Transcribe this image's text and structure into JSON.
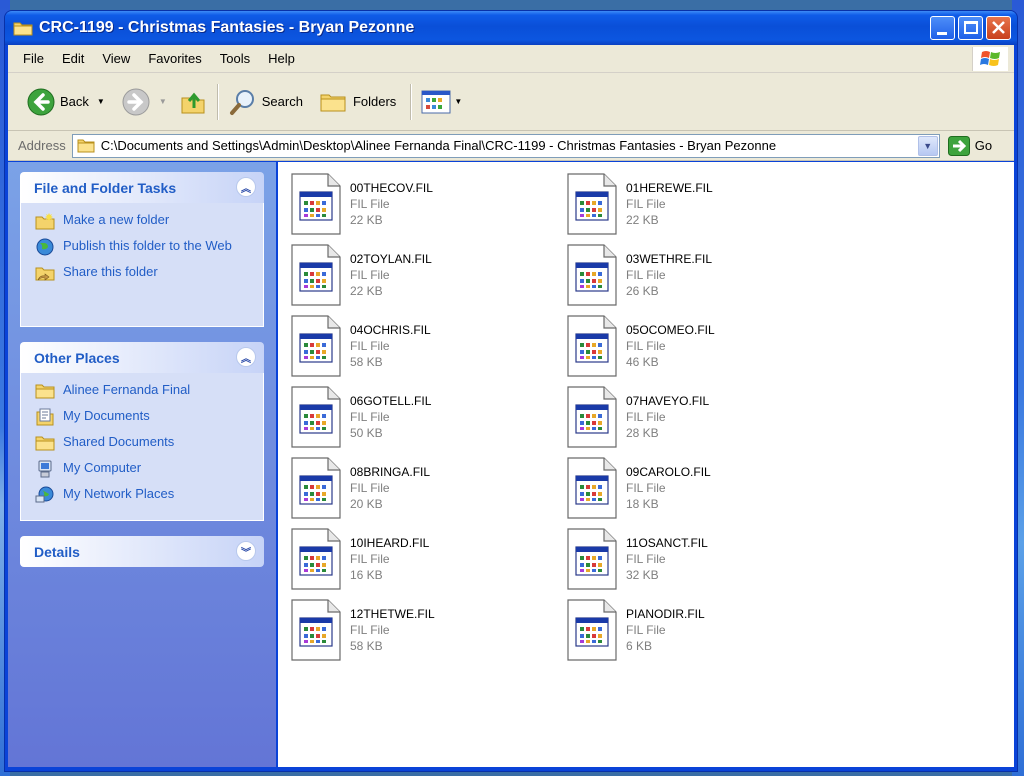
{
  "window": {
    "title": "CRC-1199 - Christmas Fantasies - Bryan Pezonne"
  },
  "menu": [
    "File",
    "Edit",
    "View",
    "Favorites",
    "Tools",
    "Help"
  ],
  "toolbar": {
    "back": "Back",
    "search": "Search",
    "folders": "Folders"
  },
  "address": {
    "label": "Address",
    "path": "C:\\Documents and Settings\\Admin\\Desktop\\Alinee Fernanda Final\\CRC-1199 - Christmas Fantasies - Bryan Pezonne",
    "go": "Go"
  },
  "sidebar": {
    "tasks": {
      "title": "File and Folder Tasks",
      "items": [
        "Make a new folder",
        "Publish this folder to the Web",
        "Share this folder"
      ]
    },
    "places": {
      "title": "Other Places",
      "items": [
        "Alinee Fernanda Final",
        "My Documents",
        "Shared Documents",
        "My Computer",
        "My Network Places"
      ]
    },
    "details": {
      "title": "Details"
    }
  },
  "files": [
    {
      "name": "00THECOV.FIL",
      "type": "FIL File",
      "size": "22 KB"
    },
    {
      "name": "01HEREWE.FIL",
      "type": "FIL File",
      "size": "22 KB"
    },
    {
      "name": "02TOYLAN.FIL",
      "type": "FIL File",
      "size": "22 KB"
    },
    {
      "name": "03WETHRE.FIL",
      "type": "FIL File",
      "size": "26 KB"
    },
    {
      "name": "04OCHRIS.FIL",
      "type": "FIL File",
      "size": "58 KB"
    },
    {
      "name": "05OCOMEO.FIL",
      "type": "FIL File",
      "size": "46 KB"
    },
    {
      "name": "06GOTELL.FIL",
      "type": "FIL File",
      "size": "50 KB"
    },
    {
      "name": "07HAVEYO.FIL",
      "type": "FIL File",
      "size": "28 KB"
    },
    {
      "name": "08BRINGA.FIL",
      "type": "FIL File",
      "size": "20 KB"
    },
    {
      "name": "09CAROLO.FIL",
      "type": "FIL File",
      "size": "18 KB"
    },
    {
      "name": "10IHEARD.FIL",
      "type": "FIL File",
      "size": "16 KB"
    },
    {
      "name": "11OSANCT.FIL",
      "type": "FIL File",
      "size": "32 KB"
    },
    {
      "name": "12THETWE.FIL",
      "type": "FIL File",
      "size": "58 KB"
    },
    {
      "name": "PIANODIR.FIL",
      "type": "FIL File",
      "size": "6 KB"
    }
  ]
}
